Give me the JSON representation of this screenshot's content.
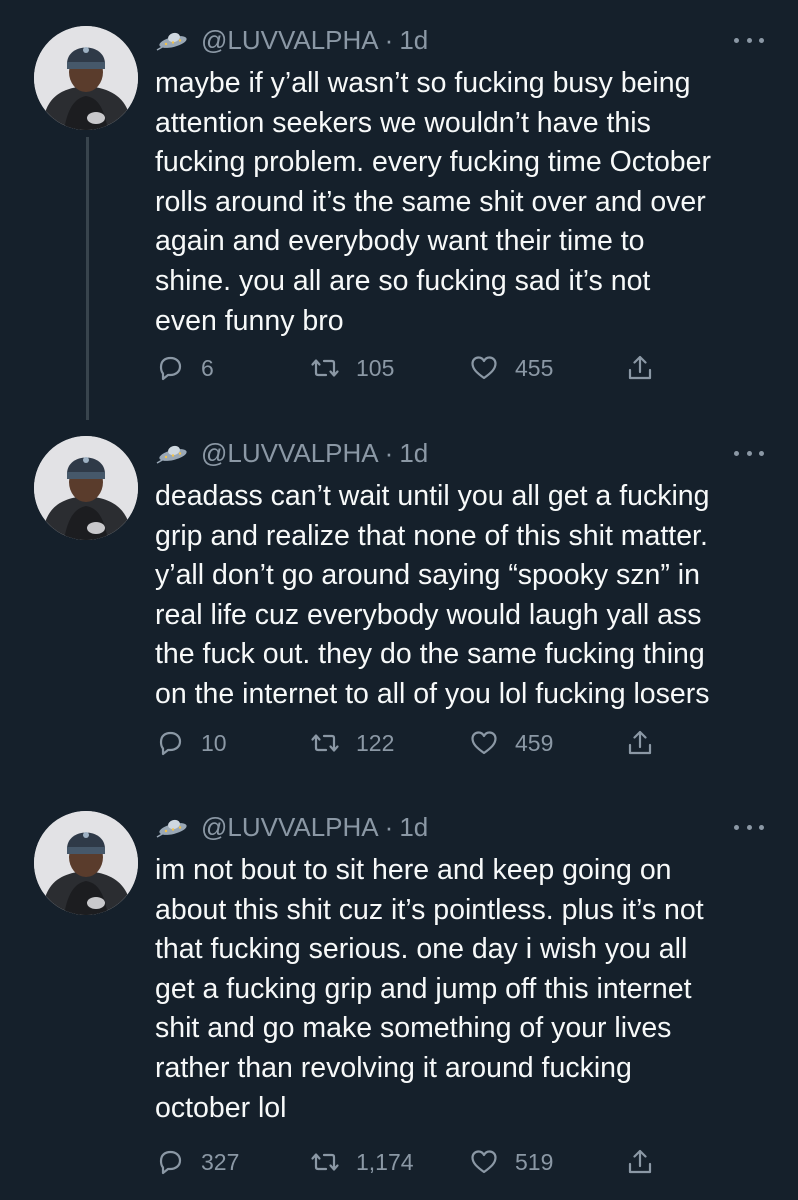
{
  "tweets": [
    {
      "handle": "@LUVVALPHA",
      "separator": "·",
      "time": "1d",
      "text": "maybe if y’all wasn’t so fucking busy being\nattention seekers we wouldn’t have this\nfucking problem. every fucking time October\nrolls around it’s the same shit over and over\nagain and everybody want their time to\nshine. you all are so fucking sad it’s not\neven funny bro",
      "replies": "6",
      "retweets": "105",
      "likes": "455"
    },
    {
      "handle": "@LUVVALPHA",
      "separator": "·",
      "time": "1d",
      "text": "deadass can’t wait until you all get a fucking\ngrip and realize that none of this shit matter.\ny’all don’t go around saying “spooky szn” in\nreal life cuz everybody would laugh yall ass\nthe fuck out. they do the same fucking thing\non the internet to all of you lol fucking losers",
      "replies": "10",
      "retweets": "122",
      "likes": "459"
    },
    {
      "handle": "@LUVVALPHA",
      "separator": "·",
      "time": "1d",
      "text": "im not bout to sit here and keep going on\nabout this shit cuz it’s pointless. plus it’s not\nthat fucking serious. one day i wish you all\nget a fucking grip and jump off this internet\nshit and go make something of your lives\nrather than revolving it around fucking\noctober lol",
      "replies": "327",
      "retweets": "1,174",
      "likes": "519"
    }
  ],
  "icons": {
    "name_emoji": "ufo-icon",
    "reply": "reply-icon",
    "retweet": "retweet-icon",
    "like": "heart-icon",
    "share": "share-icon",
    "more": "more-icon"
  },
  "colors": {
    "background": "#15202b",
    "text": "#f7f9f9",
    "secondary": "#8b98a5",
    "thread_line": "#38444d"
  }
}
